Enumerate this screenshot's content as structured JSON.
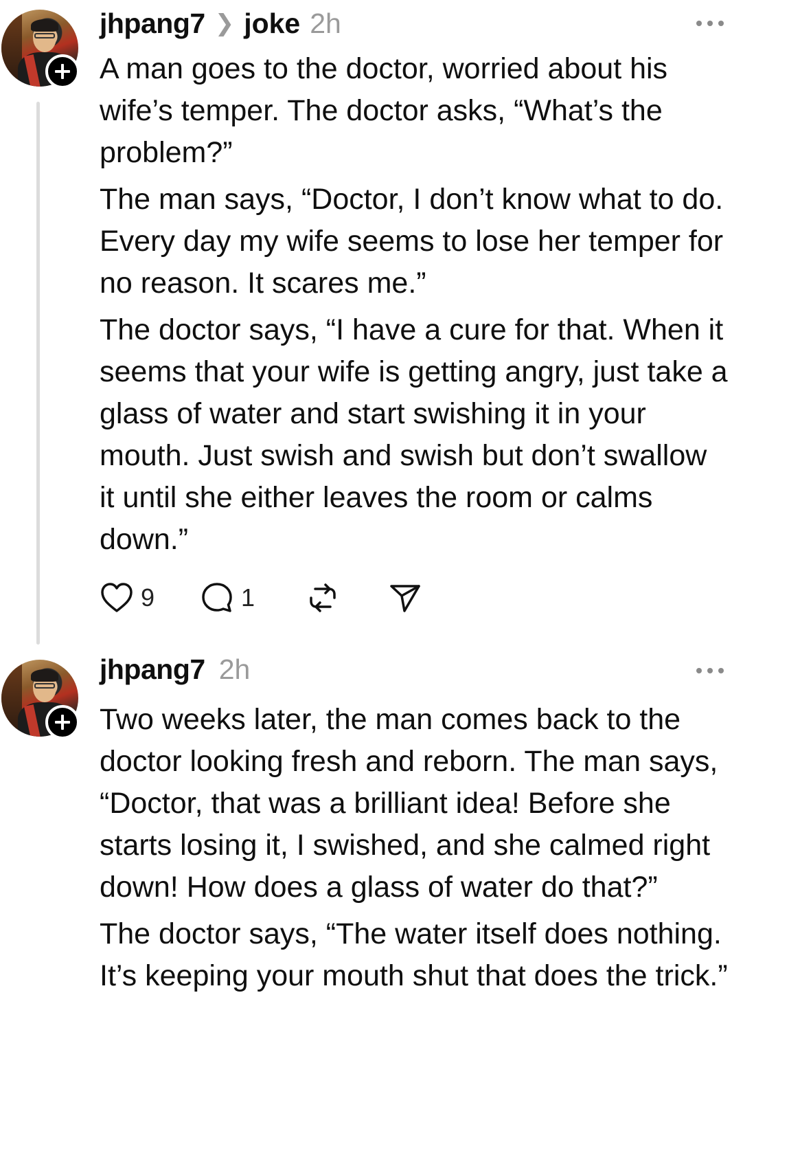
{
  "posts": [
    {
      "username": "jhpang7",
      "topic": "joke",
      "time": "2h",
      "paragraphs": [
        "A man goes to the doctor, worried about his wife’s temper. The doctor asks, “What’s the problem?”",
        "The man says, “Doctor, I don’t know what to do. Every day my wife seems to lose her temper for no reason. It scares me.”",
        "The doctor says, “I have a cure for that. When it seems that your wife is getting angry, just take a glass of water and start swishing it in your mouth. Just swish and swish but don’t swallow it until she either leaves the room or calms down.”"
      ],
      "likes": "9",
      "replies": "1"
    },
    {
      "username": "jhpang7",
      "time": "2h",
      "paragraphs": [
        "Two weeks later, the man comes back to the doctor looking fresh and reborn. The man says, “Doctor, that was a brilliant idea! Before she starts losing it, I swished, and she calmed right down! How does a glass of water do that?”",
        "The doctor says, “The water itself does nothing. It’s keeping your mouth shut that does the trick.”"
      ]
    }
  ],
  "icons": {
    "like": "heart-icon",
    "reply": "comment-icon",
    "repost": "repost-icon",
    "share": "send-icon",
    "more": "more-dots-icon",
    "follow": "plus-icon"
  }
}
